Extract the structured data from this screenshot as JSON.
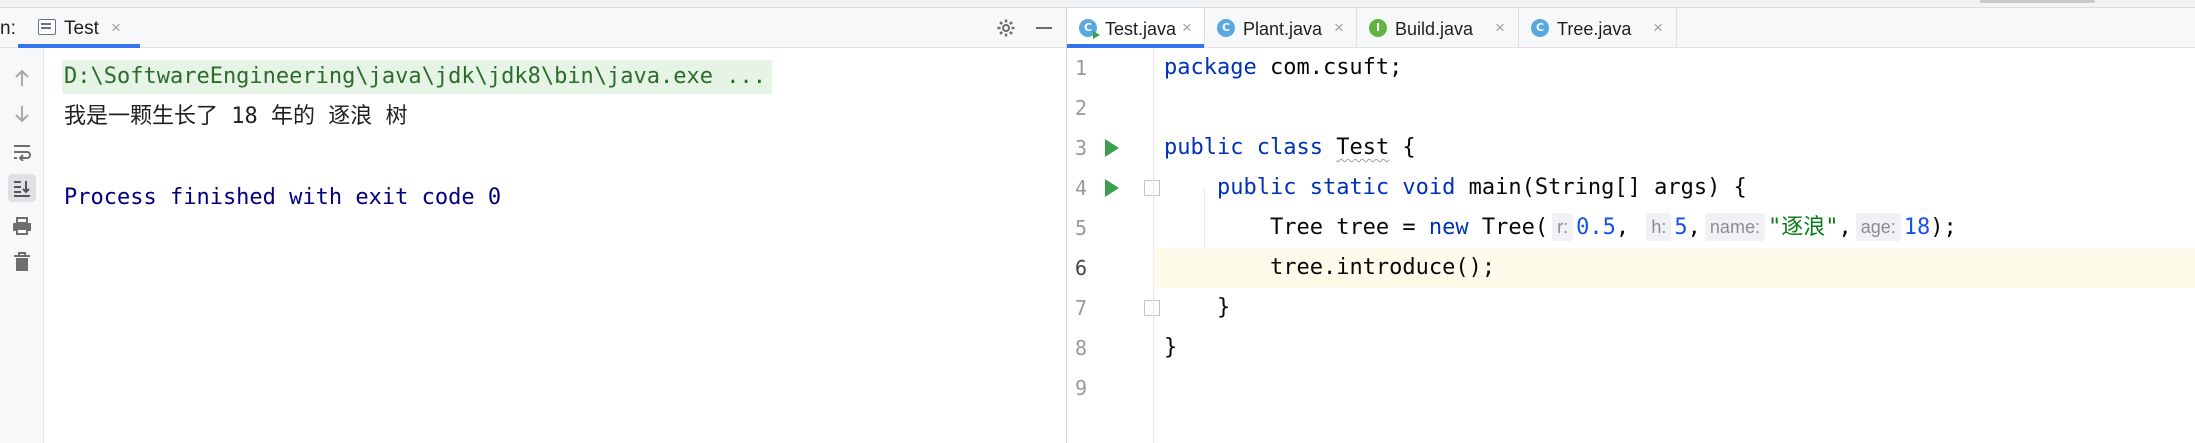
{
  "run_panel": {
    "prefix": "n:",
    "tab_label": "Test",
    "tab_close": "×",
    "icons": [
      "gear-icon",
      "minimize-icon"
    ],
    "tools": [
      "arrow-up-icon",
      "arrow-down-icon",
      "soft-wrap-icon",
      "scroll-to-end-icon",
      "print-icon",
      "trash-icon"
    ],
    "console": {
      "command": "D:\\SoftwareEngineering\\java\\jdk\\jdk8\\bin\\java.exe ...",
      "output": "我是一颗生长了 18 年的 逐浪 树",
      "exit": "Process finished with exit code 0"
    }
  },
  "editor": {
    "tabs": [
      {
        "label": "Test.java",
        "icon_letter": "C",
        "type": "class",
        "active": true
      },
      {
        "label": "Plant.java",
        "icon_letter": "C",
        "type": "class",
        "active": false
      },
      {
        "label": "Build.java",
        "icon_letter": "I",
        "type": "interface",
        "active": false
      },
      {
        "label": "Tree.java",
        "icon_letter": "C",
        "type": "class",
        "active": false
      }
    ],
    "tab_close": "×",
    "line_numbers": [
      "1",
      "2",
      "3",
      "4",
      "5",
      "6",
      "7",
      "8",
      "9"
    ],
    "code": {
      "l1_kw": "package",
      "l1_rest": " com.csuft;",
      "l3_kw": "public class",
      "l3_name": "Test",
      "l3_rest": " {",
      "l4_indent": "    ",
      "l4_kw": "public static void",
      "l4_rest": " main(String[] args) {",
      "l5_indent": "        ",
      "l5_a": "Tree tree = ",
      "l5_new": "new",
      "l5_b": " Tree(",
      "l5_hint_r": "r:",
      "l5_val_r": "0.5",
      "l5_comma1": ",",
      "l5_hint_h": "h:",
      "l5_val_h": "5",
      "l5_comma2": ",",
      "l5_hint_name": "name:",
      "l5_val_name": "\"逐浪\"",
      "l5_comma3": ",",
      "l5_hint_age": "age:",
      "l5_val_age": "18",
      "l5_end": ");",
      "l6_indent": "        ",
      "l6_text": "tree.introduce();",
      "l7_indent": "    ",
      "l7_text": "}",
      "l8_text": "}"
    }
  },
  "colors": {
    "accent": "#3574f0",
    "keyword": "#0033b3",
    "number": "#1750eb",
    "string": "#067d17",
    "console_exit": "#000080",
    "console_command": "#2d6a2d",
    "run_gutter_icon": "#3c9e4a",
    "current_line": "#fdfbe9"
  }
}
